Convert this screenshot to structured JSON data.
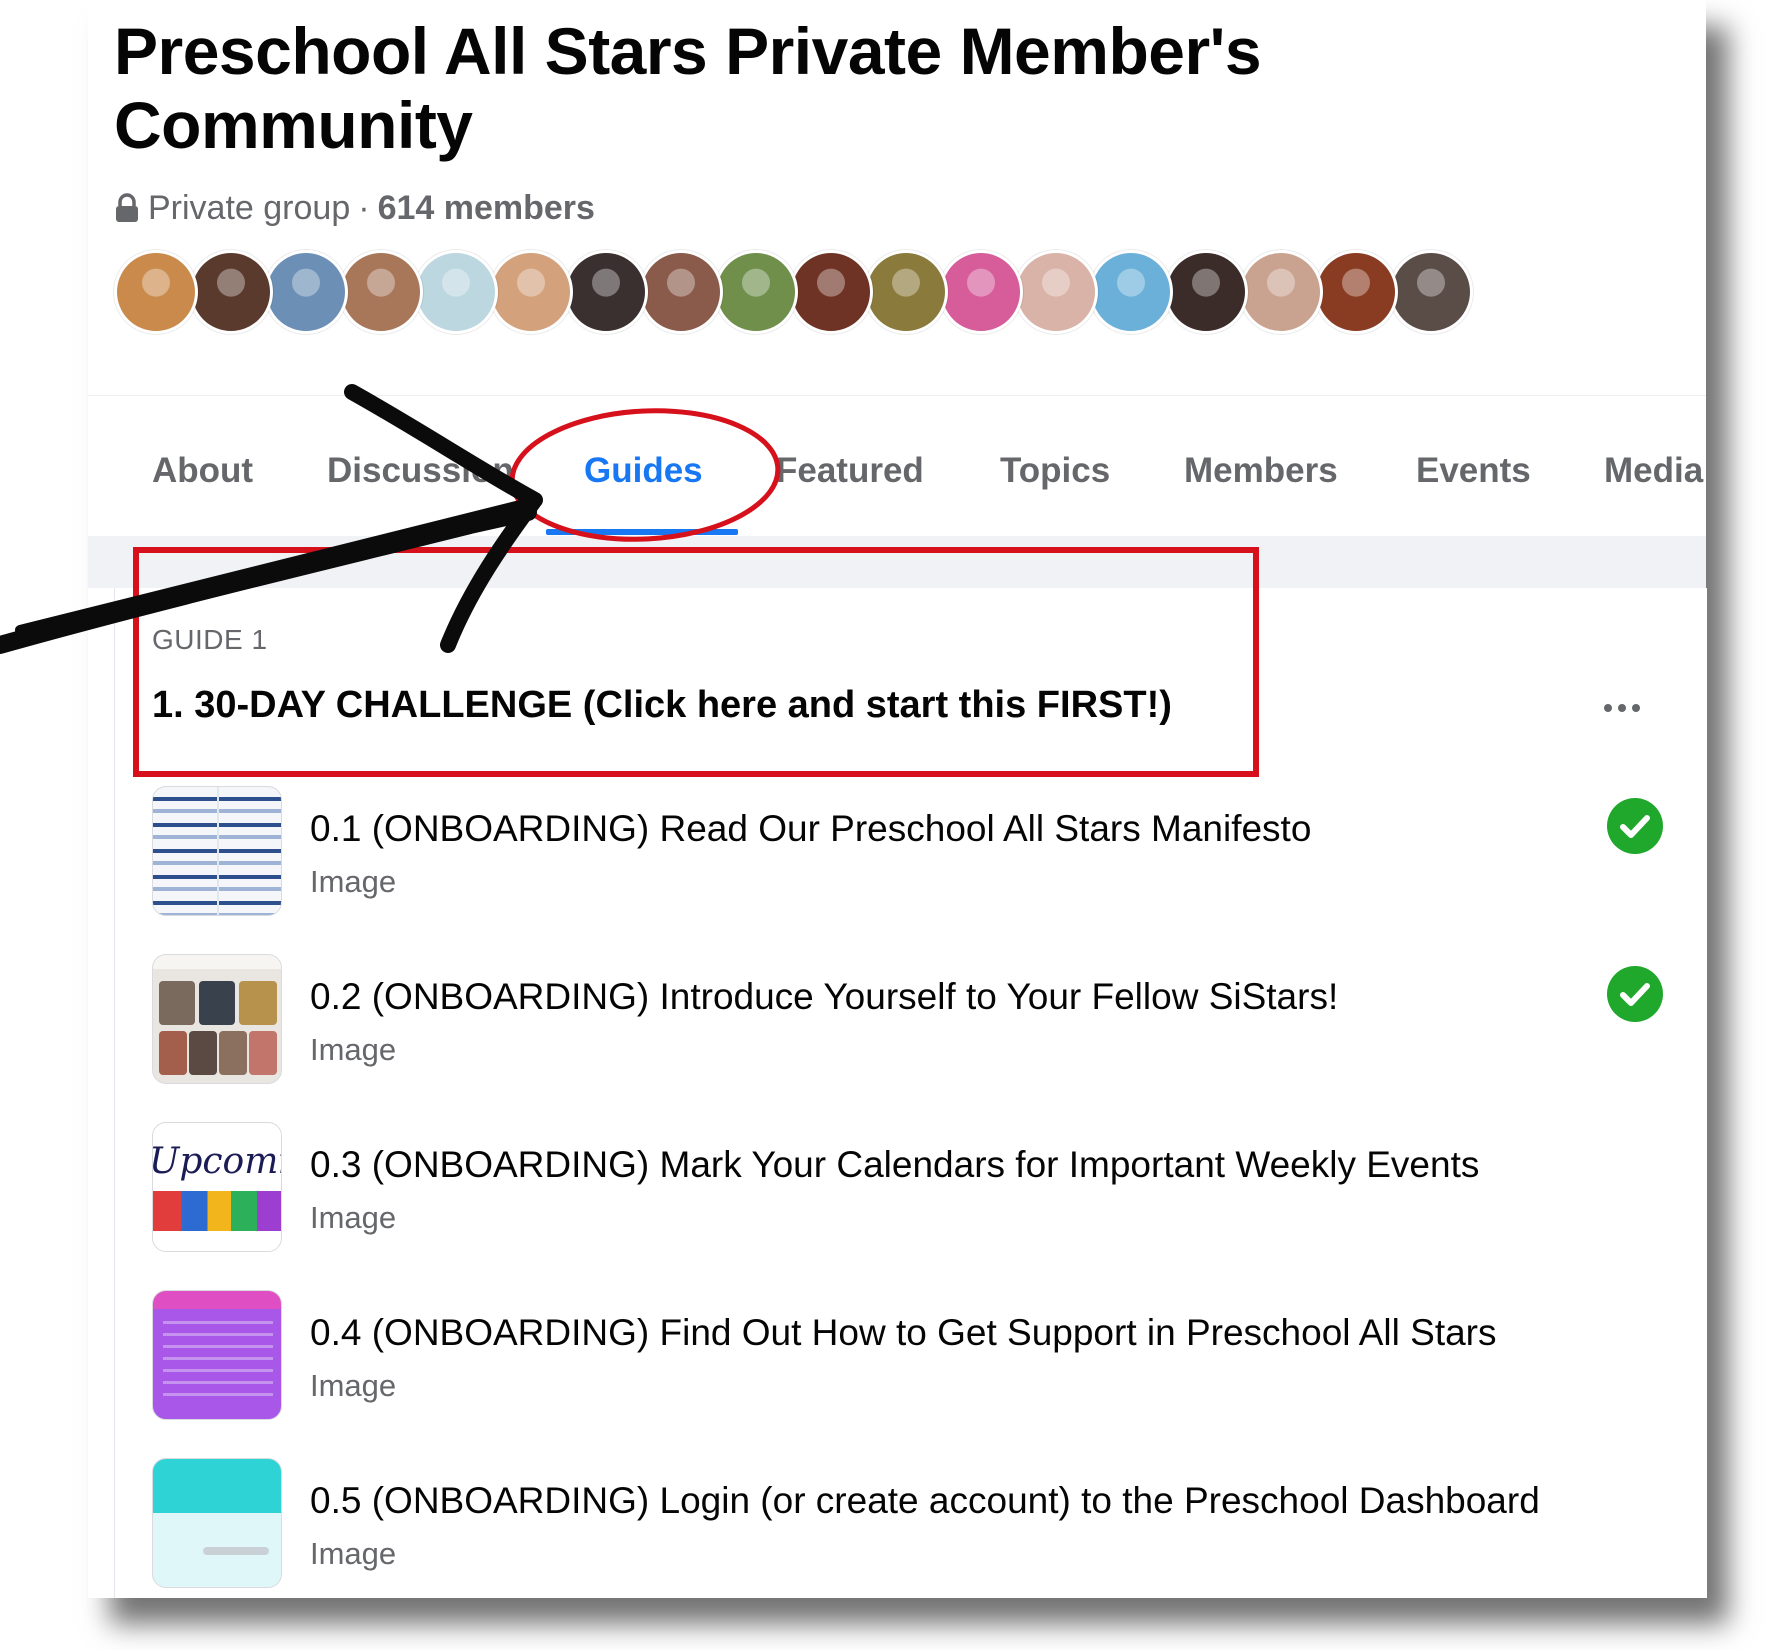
{
  "group": {
    "title": "Preschool All Stars Private Member's Community",
    "privacy": "Private group",
    "separator": "·",
    "member_count": "614 members",
    "avatar_colors": [
      "#c98a4b",
      "#5b3a2e",
      "#6c8fb6",
      "#a8775a",
      "#bcd7e0",
      "#d3a27c",
      "#3a3030",
      "#8a5a4a",
      "#6f8f4b",
      "#6e3324",
      "#8a7a3c",
      "#d65c9a",
      "#d9b3a8",
      "#6ab0d8",
      "#3b2c2a",
      "#c9a390",
      "#8a3c22",
      "#5a4d48"
    ]
  },
  "tabs": [
    {
      "label": "About",
      "active": false
    },
    {
      "label": "Discussion",
      "active": false
    },
    {
      "label": "Guides",
      "active": true
    },
    {
      "label": "Featured",
      "active": false
    },
    {
      "label": "Topics",
      "active": false
    },
    {
      "label": "Members",
      "active": false
    },
    {
      "label": "Events",
      "active": false
    },
    {
      "label": "Media",
      "active": false
    }
  ],
  "guide": {
    "label": "GUIDE 1",
    "title": "1. 30-DAY CHALLENGE (Click here and start this FIRST!)",
    "more_icon": "more-horizontal-icon"
  },
  "items": [
    {
      "title": "0.1 (ONBOARDING) Read Our Preschool All Stars Manifesto",
      "type": "Image",
      "completed": true
    },
    {
      "title": "0.2 (ONBOARDING) Introduce Yourself to Your Fellow SiStars!",
      "type": "Image",
      "completed": true
    },
    {
      "title": "0.3 (ONBOARDING) Mark Your Calendars for Important Weekly Events",
      "type": "Image",
      "completed": false
    },
    {
      "title": "0.4 (ONBOARDING) Find Out How to Get Support in Preschool All Stars",
      "type": "Image",
      "completed": false
    },
    {
      "title": "0.5 (ONBOARDING) Login (or create account) to the Preschool Dashboard",
      "type": "Image",
      "completed": false
    }
  ],
  "colors": {
    "accent": "#1877f2",
    "check": "#1fa82b",
    "annotation": "#d7111c",
    "secondary_text": "#65676b"
  }
}
